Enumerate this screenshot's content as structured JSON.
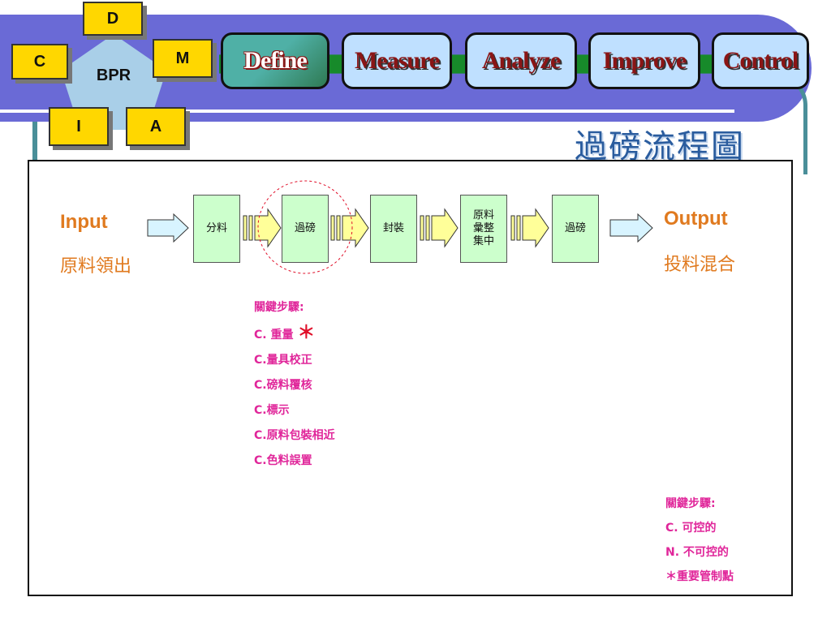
{
  "bpr": {
    "center": "BPR",
    "nodes": {
      "d": "D",
      "c": "C",
      "m": "M",
      "i": "I",
      "a": "A"
    }
  },
  "tabs": [
    {
      "label": "Define"
    },
    {
      "label": "Measure"
    },
    {
      "label": "Analyze"
    },
    {
      "label": "Improve"
    },
    {
      "label": "Control"
    }
  ],
  "title": "過磅流程圖",
  "input": {
    "label": "Input",
    "sub": "原料領出"
  },
  "output": {
    "label": "Output",
    "sub": "投料混合"
  },
  "steps": [
    {
      "label": "分料"
    },
    {
      "label": "過磅"
    },
    {
      "label": "封裝"
    },
    {
      "label": "原料\n彙整\n集中"
    },
    {
      "label": "過磅"
    }
  ],
  "key_steps": {
    "heading": "關鍵步驟:",
    "items": [
      "C. 重量",
      "C.量具校正",
      "C.磅料覆核",
      "C.標示",
      "C.原料包裝相近",
      "C.色料誤置"
    ],
    "star": "＊"
  },
  "legend": {
    "heading": "關鍵步驟:",
    "items": [
      "C. 可控的",
      "N. 不可控的",
      "＊重要管制點"
    ]
  },
  "colors": {
    "header_band": "#6a6ad6",
    "tab_fill": "#bfe0ff",
    "step_fill": "#ccffcc",
    "arrow_fill": "#ffff99",
    "input_output_text": "#e07a1f",
    "key_text": "#e0269a",
    "title_text": "#2a5c9e"
  }
}
